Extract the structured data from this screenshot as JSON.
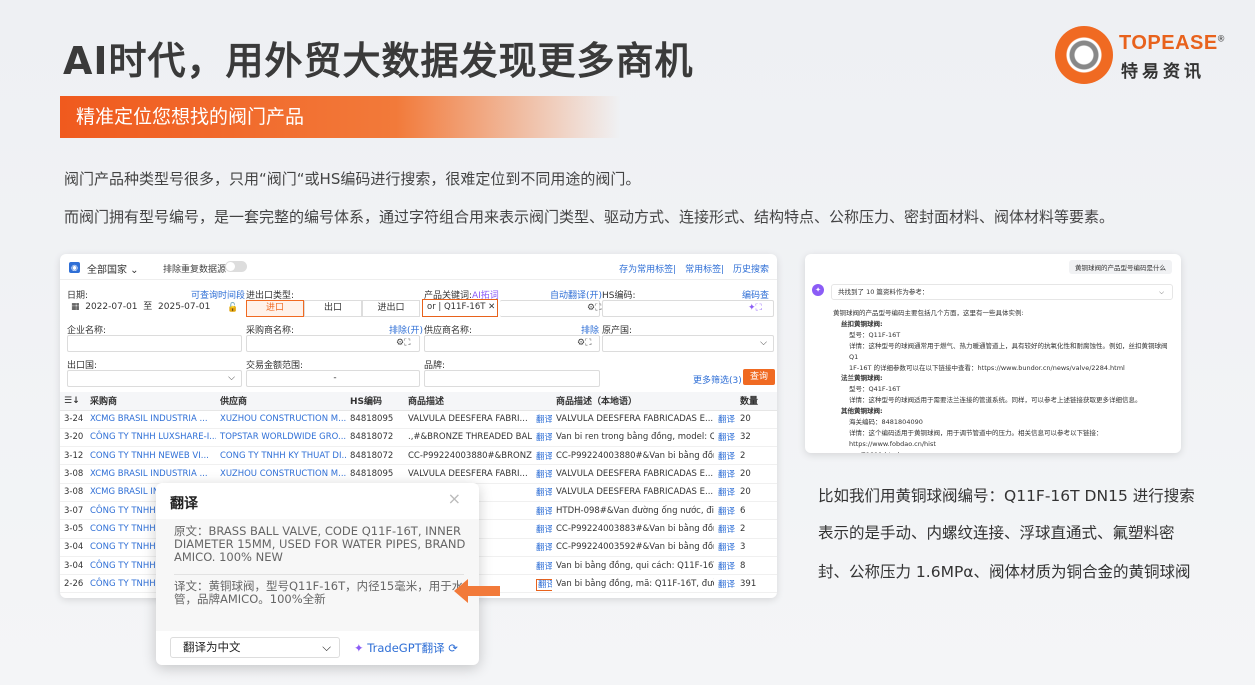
{
  "title": "AI时代，用外贸大数据发现更多商机",
  "logo": {
    "en": "TOPEASE",
    "reg": "®",
    "cn": "特易资讯"
  },
  "banner": "精准定位您想找的阀门产品",
  "paragraphs": [
    "阀门产品种类型号很多，只用“阀门“或HS编码进行搜索，很难定位到不同用途的阀门。",
    "而阀门拥有型号编号，是一套完整的编号体系，通过字符组合用来表示阀门类型、驱动方式、连接形式、结构特点、公称压力、密封面材料、阀体材料等要素。"
  ],
  "app": {
    "country": "全部国家 ⌄",
    "dedupe": "排除重复数据源",
    "links": [
      "存为常用标签",
      "常用标签",
      "历史搜索"
    ],
    "date_label": "日期:",
    "date_hint": "可查询时间段",
    "date_from": "2022-07-01",
    "date_to_word": "至",
    "date_to": "2025-07-01",
    "trade_type_label": "进出口类型:",
    "trade_types": [
      "进口",
      "出口",
      "进出口"
    ],
    "keyword_label": "产品关键词:",
    "keyword_ai": "AI拓词",
    "keyword_auto": "自动翻译(开)",
    "keyword_value": "or | Q11F-16T ✕",
    "hs_label": "HS编码:",
    "hs_query": "编码查询",
    "company_label": "企业名称:",
    "buyer_label": "采购商名称:",
    "buyer_excl": "排除(开)",
    "supplier_label": "供应商名称:",
    "supplier_excl": "排除",
    "origin_label": "原产国:",
    "export_label": "出口国:",
    "amount_label": "交易金额范围:",
    "amount_sep": "-",
    "brand_label": "品牌:",
    "more_filter": "更多筛选(3)",
    "query_btn": "查询",
    "columns": [
      "",
      "采购商",
      "供应商",
      "HS编码",
      "商品描述",
      "",
      "商品描述（本地语）",
      "",
      "数量"
    ],
    "rows": [
      [
        "3-24",
        "XCMG BRASIL INDUSTRIA ...",
        "XUZHOU CONSTRUCTION M...",
        "84818095",
        "VALVULA DEESFERA FABRI...",
        "翻译",
        "VALVULA DEESFERA FABRICADAS E...",
        "翻译",
        "20"
      ],
      [
        "3-20",
        "CÔNG TY TNHH LUXSHARE-I...",
        "TOPSTAR WORLDWIDE GRO...",
        "84818072",
        ".,#&BRONZE THREADED BAL...",
        "翻译",
        "Van bi ren trong bằng đồng, model: Q11...",
        "翻译",
        "32"
      ],
      [
        "3-12",
        "CONG TY TNHH NEWEB VI...",
        "CONG TY TNHH KY THUAT DI...",
        "84818072",
        "CC-P99224003880#&BRONZ...",
        "翻译",
        "CC-P99224003880#&Van bi bằng đồng ...",
        "翻译",
        "2"
      ],
      [
        "3-08",
        "XCMG BRASIL INDUSTRIA ...",
        "XUZHOU CONSTRUCTION M...",
        "84818095",
        "VALVULA DEESFERA FABRI...",
        "翻译",
        "VALVULA DEESFERA FABRICADAS E...",
        "翻译",
        "20"
      ],
      [
        "3-08",
        "XCMG BRASIL IN",
        "",
        "",
        "RA FABRI...",
        "翻译",
        "VALVULA DEESFERA FABRICADAS E...",
        "翻译",
        "20"
      ],
      [
        "3-07",
        "CÔNG TY TNHH",
        "",
        "",
        "R PIPE VA...",
        "翻译",
        "HTDH-098#&Van đường ống nước, điều...",
        "翻译",
        "6"
      ],
      [
        "3-05",
        "CONG TY TNHH",
        "",
        "",
        "#&BRONZ...",
        "翻译",
        "CC-P99224003883#&Van bi bằng đồng ...",
        "翻译",
        "2"
      ],
      [
        "3-04",
        "CONG TY TNHH",
        "",
        "",
        "#&BRONZ...",
        "翻译",
        "CC-P99224003592#&Van bi bằng đồng ...",
        "翻译",
        "3"
      ],
      [
        "3-04",
        "CÔNG TY TNHH",
        "",
        "",
        "E, SPECIF...",
        "翻译",
        "Van bi bằng đồng, qui cách: Q11F-16T, k...",
        "翻译",
        "8"
      ],
      [
        "2-26",
        "CÔNG TY TNHH",
        "",
        "",
        "E, CODE ...",
        "翻译",
        "Van bi bằng đồng, mã: Q11F-16T, đường...",
        "翻译",
        "391"
      ]
    ]
  },
  "popup": {
    "title": "翻译",
    "close": "×",
    "original": "原文：BRASS BALL VALVE, CODE Q11F-16T, INNER DIAMETER 15MM, USED FOR WATER PIPES, BRAND AMICO. 100% NEW",
    "translated": "译文：黄铜球阀，型号Q11F-16T，内径15毫米，用于水管，品牌AMICO。100%全新",
    "select": "翻译为中文",
    "gpt": "TradeGPT翻译"
  },
  "ai": {
    "question": "黄铜球阀的产品型号编码是什么",
    "refs": "共找到了 10 篇资料作为参考：",
    "lines": [
      {
        "c": "",
        "t": "黄铜球阀的产品型号编码主要包括几个方面，这里有一些具体实例:"
      },
      {
        "c": "i1",
        "t": "丝扣黄铜球阀:"
      },
      {
        "c": "i2",
        "t": "型号：Q11F-16T"
      },
      {
        "c": "i2",
        "t": "详情：这种型号的球阀通常用于燃气、热力暖通管道上，具有较好的抗氧化性和耐腐蚀性。例如，丝扣黄铜球阀 Q1"
      },
      {
        "c": "i2",
        "t": "1F-16T 的详细参数可以在以下链接中查看：https://www.bundor.cn/news/valve/2284.html"
      },
      {
        "c": "i1",
        "t": "法兰黄铜球阀:"
      },
      {
        "c": "i2",
        "t": "型号：Q41F-16T"
      },
      {
        "c": "i2",
        "t": "详情：这种型号的球阀适用于需要法兰连接的管道系统。同样，可以参考上述链接获取更多详细信息。"
      },
      {
        "c": "i1",
        "t": "其他黄铜球阀:"
      },
      {
        "c": "i2",
        "t": "海关编码：8481804090"
      },
      {
        "c": "i2",
        "t": "详情：这个编码适用于黄铜球阀，用于调节管道中的压力。相关信息可以参考以下链接：https://www.fobdao.cn/hist"
      },
      {
        "c": "i2",
        "t": "ory/71811.html"
      },
      {
        "c": "",
        "t": "希望这些信息对您有所帮助！如果您需要更多详细信息，可以访问上述链接或进一步搜索相关资料。"
      }
    ]
  },
  "desc": [
    "比如我们用黄铜球阀编号：Q11F-16T DN15 进行搜索",
    "表示的是手动、内螺纹连接、浮球直通式、氟塑料密",
    "封、公称压力 1.6MPα、阀体材质为铜合金的黄铜球阀"
  ],
  "colors": {
    "accent": "#f06a22",
    "link": "#2f6fd6",
    "highlight": "#ffee00"
  }
}
